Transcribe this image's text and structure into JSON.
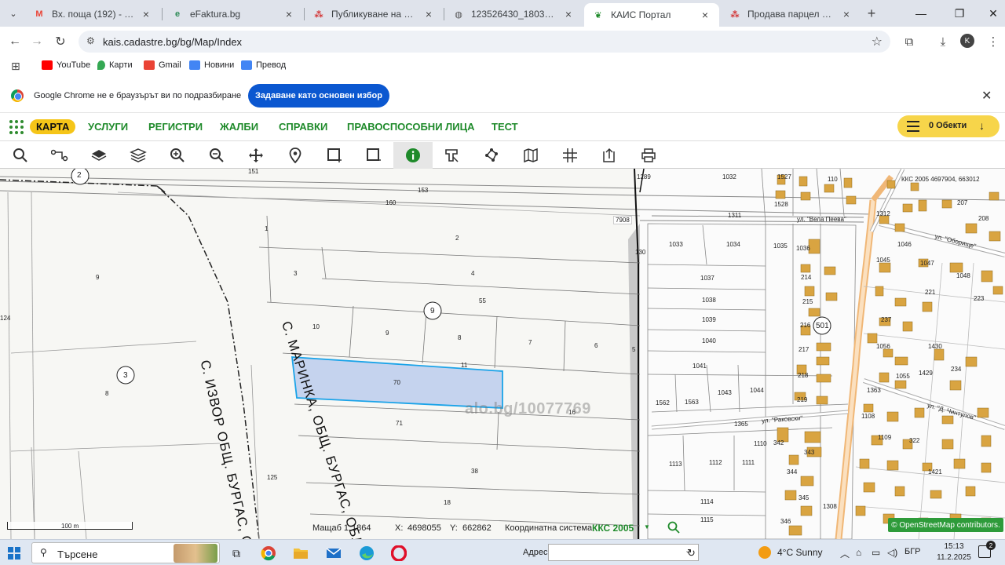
{
  "tabs": [
    {
      "title": "Вх. поща (192) - ruschevi.g",
      "favicon": "gmail-icon",
      "active": false
    },
    {
      "title": "eFaktura.bg",
      "favicon": "efaktura-icon",
      "active": false
    },
    {
      "title": "Публикуване на обява - !",
      "favicon": "alo-icon",
      "active": false
    },
    {
      "title": "123526430_1803575184.p",
      "favicon": "globe-icon",
      "active": false
    },
    {
      "title": "КАИС Портал",
      "favicon": "kais-icon",
      "active": true
    },
    {
      "title": "Продава парцел в с. Мар",
      "favicon": "alo-icon",
      "active": false
    }
  ],
  "address": {
    "url": "kais.cadastre.bg/bg/Map/Index"
  },
  "profile_initial": "K",
  "bookmarks": [
    {
      "label": "YouTube",
      "color": "#ff0000"
    },
    {
      "label": "Карти",
      "color": "#34a853"
    },
    {
      "label": "Gmail",
      "color": "#ea4335"
    },
    {
      "label": "Новини",
      "color": "#4285f4"
    },
    {
      "label": "Превод",
      "color": "#4285f4"
    }
  ],
  "infobar": {
    "message": "Google Chrome не е браузърът ви по подразбиране",
    "button": "Задаване като основен избор"
  },
  "menu": {
    "items": [
      "КАРТА",
      "УСЛУГИ",
      "РЕГИСТРИ",
      "ЖАЛБИ",
      "СПРАВКИ",
      "ПРАВОСПОСОБНИ ЛИЦА",
      "ТЕСТ"
    ],
    "active_index": 0,
    "objects_label": "0 Обекти"
  },
  "tools": [
    "search-icon",
    "route-icon",
    "layers-icon",
    "layers-stack-icon",
    "zoom-in-icon",
    "zoom-out-icon",
    "pan-icon",
    "location-pin-icon",
    "select-rect-icon",
    "select-area-icon",
    "info-icon",
    "measure-icon",
    "polygon-icon",
    "map-book-icon",
    "grid-icon",
    "export-icon",
    "print-icon"
  ],
  "map": {
    "parcel_numbers": [
      {
        "n": "151"
      },
      {
        "n": "153"
      },
      {
        "n": "160"
      },
      {
        "n": "1"
      },
      {
        "n": "2"
      },
      {
        "n": "3"
      },
      {
        "n": "4"
      },
      {
        "n": "55"
      },
      {
        "n": "9"
      },
      {
        "n": "10"
      },
      {
        "n": "8"
      },
      {
        "n": "7"
      },
      {
        "n": "6"
      },
      {
        "n": "5"
      },
      {
        "n": "11"
      },
      {
        "n": "70"
      },
      {
        "n": "16"
      },
      {
        "n": "71"
      },
      {
        "n": "38"
      },
      {
        "n": "18"
      },
      {
        "n": "125"
      },
      {
        "n": "8"
      },
      {
        "n": "9"
      },
      {
        "n": "124"
      },
      {
        "n": "130"
      },
      {
        "n": "1033"
      },
      {
        "n": "1034"
      },
      {
        "n": "1035"
      },
      {
        "n": "1036"
      },
      {
        "n": "1037"
      },
      {
        "n": "1038"
      },
      {
        "n": "1039"
      },
      {
        "n": "1040"
      },
      {
        "n": "1041"
      },
      {
        "n": "1043"
      },
      {
        "n": "1044"
      },
      {
        "n": "1562"
      },
      {
        "n": "1563"
      },
      {
        "n": "1365"
      },
      {
        "n": "1110"
      },
      {
        "n": "1113"
      },
      {
        "n": "1112"
      },
      {
        "n": "1111"
      },
      {
        "n": "1114"
      },
      {
        "n": "1115"
      },
      {
        "n": "1032"
      },
      {
        "n": "1527"
      },
      {
        "n": "1528"
      },
      {
        "n": "110"
      },
      {
        "n": "1311"
      },
      {
        "n": "214"
      },
      {
        "n": "215"
      },
      {
        "n": "216"
      },
      {
        "n": "217"
      },
      {
        "n": "218"
      },
      {
        "n": "219"
      },
      {
        "n": "342"
      },
      {
        "n": "343"
      },
      {
        "n": "344"
      },
      {
        "n": "345"
      },
      {
        "n": "346"
      },
      {
        "n": "1308"
      },
      {
        "n": "1046"
      },
      {
        "n": "1045"
      },
      {
        "n": "1047"
      },
      {
        "n": "1048"
      },
      {
        "n": "221"
      },
      {
        "n": "223"
      },
      {
        "n": "237"
      },
      {
        "n": "1056"
      },
      {
        "n": "1430"
      },
      {
        "n": "1429"
      },
      {
        "n": "234"
      },
      {
        "n": "1055"
      },
      {
        "n": "1363"
      },
      {
        "n": "1108"
      },
      {
        "n": "1109"
      },
      {
        "n": "322"
      },
      {
        "n": "1421"
      },
      {
        "n": "1312"
      },
      {
        "n": "207"
      },
      {
        "n": "208"
      },
      {
        "n": "7908"
      },
      {
        "n": "1289"
      }
    ],
    "circle_labels": [
      "2",
      "9",
      "3",
      "501"
    ],
    "street_labels": [
      "ул. \"Вела Пеева\"",
      "ул. \"Раковски\"",
      "ул. \"Оборище\"",
      "ул. \"Д. Чинтулов\""
    ],
    "big_labels": [
      "С. ИЗВОР ОБЩ. БУРГАС, ОБЛ",
      "С. МАРИНКА, ОБЩ. БУРГАС, ОБЛ"
    ],
    "top_coords": "ККС 2005 4697904, 663012",
    "watermark": "alo.bg/10077769",
    "attribution": "© OpenStreetMap contributors.",
    "highlight_color": "#c5d3ee"
  },
  "status": {
    "scale_label": "100 m",
    "scale_text": "Мащаб 1:",
    "scale_value": "1864",
    "x_label": "X:",
    "x_value": "4698055",
    "y_label": "Y:",
    "y_value": "662862",
    "crs_label": "Координатна система:",
    "crs_value": "ККС 2005"
  },
  "taskbar": {
    "search_placeholder": "Търсене",
    "address_label": "Адрес",
    "weather": "4°C  Sunny",
    "lang": "БГР",
    "time": "15:13",
    "date": "11.2.2025 г.",
    "notifications": "2"
  }
}
